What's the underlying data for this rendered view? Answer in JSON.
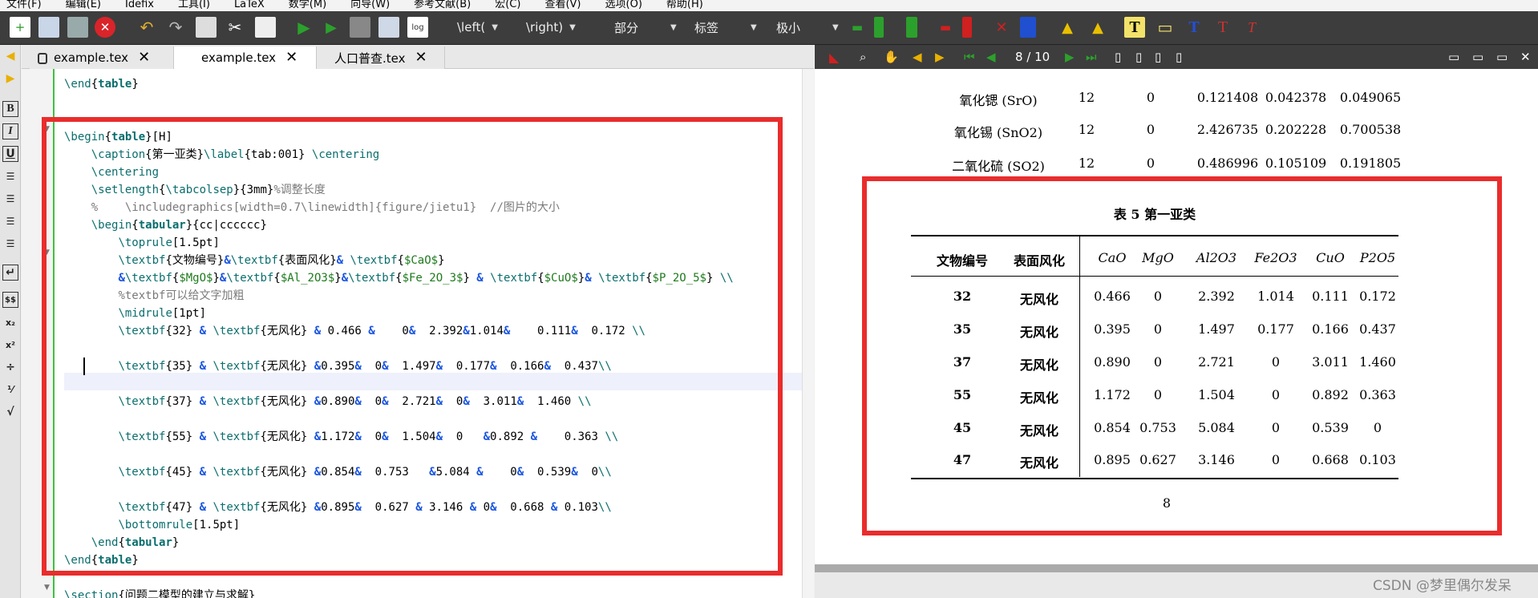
{
  "menu": [
    "文件(F)",
    "编辑(E)",
    "Idefix",
    "工具(I)",
    "LaTeX",
    "数学(M)",
    "向导(W)",
    "参考文献(B)",
    "宏(C)",
    "查看(V)",
    "选项(O)",
    "帮助(H)"
  ],
  "toolbar": {
    "left_delim": "\\left(",
    "right_delim": "\\right)",
    "part": "部分",
    "label": "标签",
    "size": "极小"
  },
  "tabs": [
    {
      "label": "example.tex",
      "locked": true
    },
    {
      "label": "example.tex",
      "active": true
    },
    {
      "label": "人口普查.tex"
    }
  ],
  "code_lines": [
    {
      "html": "<span class='cmd'>\\end</span>{<span class='kw'>table</span>}"
    },
    {
      "html": ""
    },
    {
      "html": ""
    },
    {
      "html": "<span class='cmd'>\\begin</span>{<span class='kw'>table</span>}[H]"
    },
    {
      "html": "    <span class='cmd'>\\caption</span>{第一亚类}<span class='cmd'>\\label</span>{tab:001} <span class='cmd'>\\centering</span>"
    },
    {
      "html": "    <span class='cmd'>\\centering</span>"
    },
    {
      "html": "    <span class='cmd'>\\setlength</span>{<span class='cmd'>\\tabcolsep</span>}{3mm}<span class='cm'>%调整长度</span>"
    },
    {
      "html": "    <span class='cm'>%    \\includegraphics[width=0.7\\linewidth]{figure/jietu1}  //图片的大小</span>"
    },
    {
      "html": "    <span class='cmd'>\\begin</span>{<span class='kw'>tabular</span>}{cc|cccccc}"
    },
    {
      "html": "        <span class='cmd'>\\toprule</span>[1.5pt]"
    },
    {
      "html": "        <span class='cmd'>\\textbf</span>{文物编号}<span class='amp'>&amp;</span><span class='cmd'>\\textbf</span>{表面风化}<span class='amp'>&amp;</span> <span class='cmd'>\\textbf</span>{<span class='arg'>$CaO$</span>}"
    },
    {
      "html": "        <span class='amp'>&amp;</span><span class='cmd'>\\textbf</span>{<span class='arg'>$MgO$</span>}<span class='amp'>&amp;</span><span class='cmd'>\\textbf</span>{<span class='arg'>$Al_2O3$</span>}<span class='amp'>&amp;</span><span class='cmd'>\\textbf</span>{<span class='arg'>$Fe_2O_3$</span>} <span class='amp'>&amp;</span> <span class='cmd'>\\textbf</span>{<span class='arg'>$CuO$</span>}<span class='amp'>&amp;</span> <span class='cmd'>\\textbf</span>{<span class='arg'>$P_2O_5$</span>} <span class='cmd'>\\\\</span>"
    },
    {
      "html": "        <span class='cm'>%textbf可以给文字加粗</span>"
    },
    {
      "html": "        <span class='cmd'>\\midrule</span>[1pt]"
    },
    {
      "html": "        <span class='cmd'>\\textbf</span>{32} <span class='amp'>&amp;</span> <span class='cmd'>\\textbf</span>{无风化} <span class='amp'>&amp;</span> 0.466 <span class='amp'>&amp;</span>    0<span class='amp'>&amp;</span>  2.392<span class='amp'>&amp;</span>1.014<span class='amp'>&amp;</span>    0.111<span class='amp'>&amp;</span>  0.172 <span class='cmd'>\\\\</span>"
    },
    {
      "html": ""
    },
    {
      "html": "        <span class='cmd'>\\textbf</span>{35} <span class='amp'>&amp;</span> <span class='cmd'>\\textbf</span>{无风化} <span class='amp'>&amp;</span>0.395<span class='amp'>&amp;</span>  0<span class='amp'>&amp;</span>  1.497<span class='amp'>&amp;</span>  0.177<span class='amp'>&amp;</span>  0.166<span class='amp'>&amp;</span>  0.437<span class='cmd'>\\\\</span>"
    },
    {
      "html": ""
    },
    {
      "html": "        <span class='cmd'>\\textbf</span>{37} <span class='amp'>&amp;</span> <span class='cmd'>\\textbf</span>{无风化} <span class='amp'>&amp;</span>0.890<span class='amp'>&amp;</span>  0<span class='amp'>&amp;</span>  2.721<span class='amp'>&amp;</span>  0<span class='amp'>&amp;</span>  3.011<span class='amp'>&amp;</span>  1.460 <span class='cmd'>\\\\</span>"
    },
    {
      "html": ""
    },
    {
      "html": "        <span class='cmd'>\\textbf</span>{55} <span class='amp'>&amp;</span> <span class='cmd'>\\textbf</span>{无风化} <span class='amp'>&amp;</span>1.172<span class='amp'>&amp;</span>  0<span class='amp'>&amp;</span>  1.504<span class='amp'>&amp;</span>  0   <span class='amp'>&amp;</span>0.892 <span class='amp'>&amp;</span>    0.363 <span class='cmd'>\\\\</span>"
    },
    {
      "html": ""
    },
    {
      "html": "        <span class='cmd'>\\textbf</span>{45} <span class='amp'>&amp;</span> <span class='cmd'>\\textbf</span>{无风化} <span class='amp'>&amp;</span>0.854<span class='amp'>&amp;</span>  0.753   <span class='amp'>&amp;</span>5.084 <span class='amp'>&amp;</span>    0<span class='amp'>&amp;</span>  0.539<span class='amp'>&amp;</span>  0<span class='cmd'>\\\\</span>"
    },
    {
      "html": ""
    },
    {
      "html": "        <span class='cmd'>\\textbf</span>{47} <span class='amp'>&amp;</span> <span class='cmd'>\\textbf</span>{无风化} <span class='amp'>&amp;</span>0.895<span class='amp'>&amp;</span>  0.627 <span class='amp'>&amp;</span> 3.146 <span class='amp'>&amp;</span> 0<span class='amp'>&amp;</span>  0.668 <span class='amp'>&amp;</span> 0.103<span class='cmd'>\\\\</span>"
    },
    {
      "html": "        <span class='cmd'>\\bottomrule</span>[1.5pt]"
    },
    {
      "html": "    <span class='cmd'>\\end</span>{<span class='kw'>tabular</span>}"
    },
    {
      "html": "<span class='cmd'>\\end</span>{<span class='kw'>table</span>}"
    },
    {
      "html": ""
    },
    {
      "html": "<span class='cmd'>\\section</span>{问题二模型的建立与求解}"
    }
  ],
  "viewer": {
    "page_indicator": "8 / 10",
    "prev_rows": [
      {
        "name": "氧化锶 (SrO)",
        "a": "12",
        "b": "0",
        "c": "0.121408",
        "d": "0.042378",
        "e": "0.049065"
      },
      {
        "name": "氧化锡 (SnO2)",
        "a": "12",
        "b": "0",
        "c": "2.426735",
        "d": "0.202228",
        "e": "0.700538"
      },
      {
        "name": "二氧化硫 (SO2)",
        "a": "12",
        "b": "0",
        "c": "0.486996",
        "d": "0.105109",
        "e": "0.191805"
      }
    ],
    "table_caption": "表 5   第一亚类",
    "headers": [
      "文物编号",
      "表面风化",
      "CaO",
      "MgO",
      "Al2O3",
      "Fe2O3",
      "CuO",
      "P2O5"
    ],
    "rows": [
      [
        "32",
        "无风化",
        "0.466",
        "0",
        "2.392",
        "1.014",
        "0.111",
        "0.172"
      ],
      [
        "35",
        "无风化",
        "0.395",
        "0",
        "1.497",
        "0.177",
        "0.166",
        "0.437"
      ],
      [
        "37",
        "无风化",
        "0.890",
        "0",
        "2.721",
        "0",
        "3.011",
        "1.460"
      ],
      [
        "55",
        "无风化",
        "1.172",
        "0",
        "1.504",
        "0",
        "0.892",
        "0.363"
      ],
      [
        "45",
        "无风化",
        "0.854",
        "0.753",
        "5.084",
        "0",
        "0.539",
        "0"
      ],
      [
        "47",
        "无风化",
        "0.895",
        "0.627",
        "3.146",
        "0",
        "0.668",
        "0.103"
      ]
    ],
    "page_number": "8"
  },
  "watermark": "CSDN @梦里偶尔发呆",
  "colors": {
    "highlight": "#ea2c2c",
    "toolbar": "#3d3d3d"
  }
}
